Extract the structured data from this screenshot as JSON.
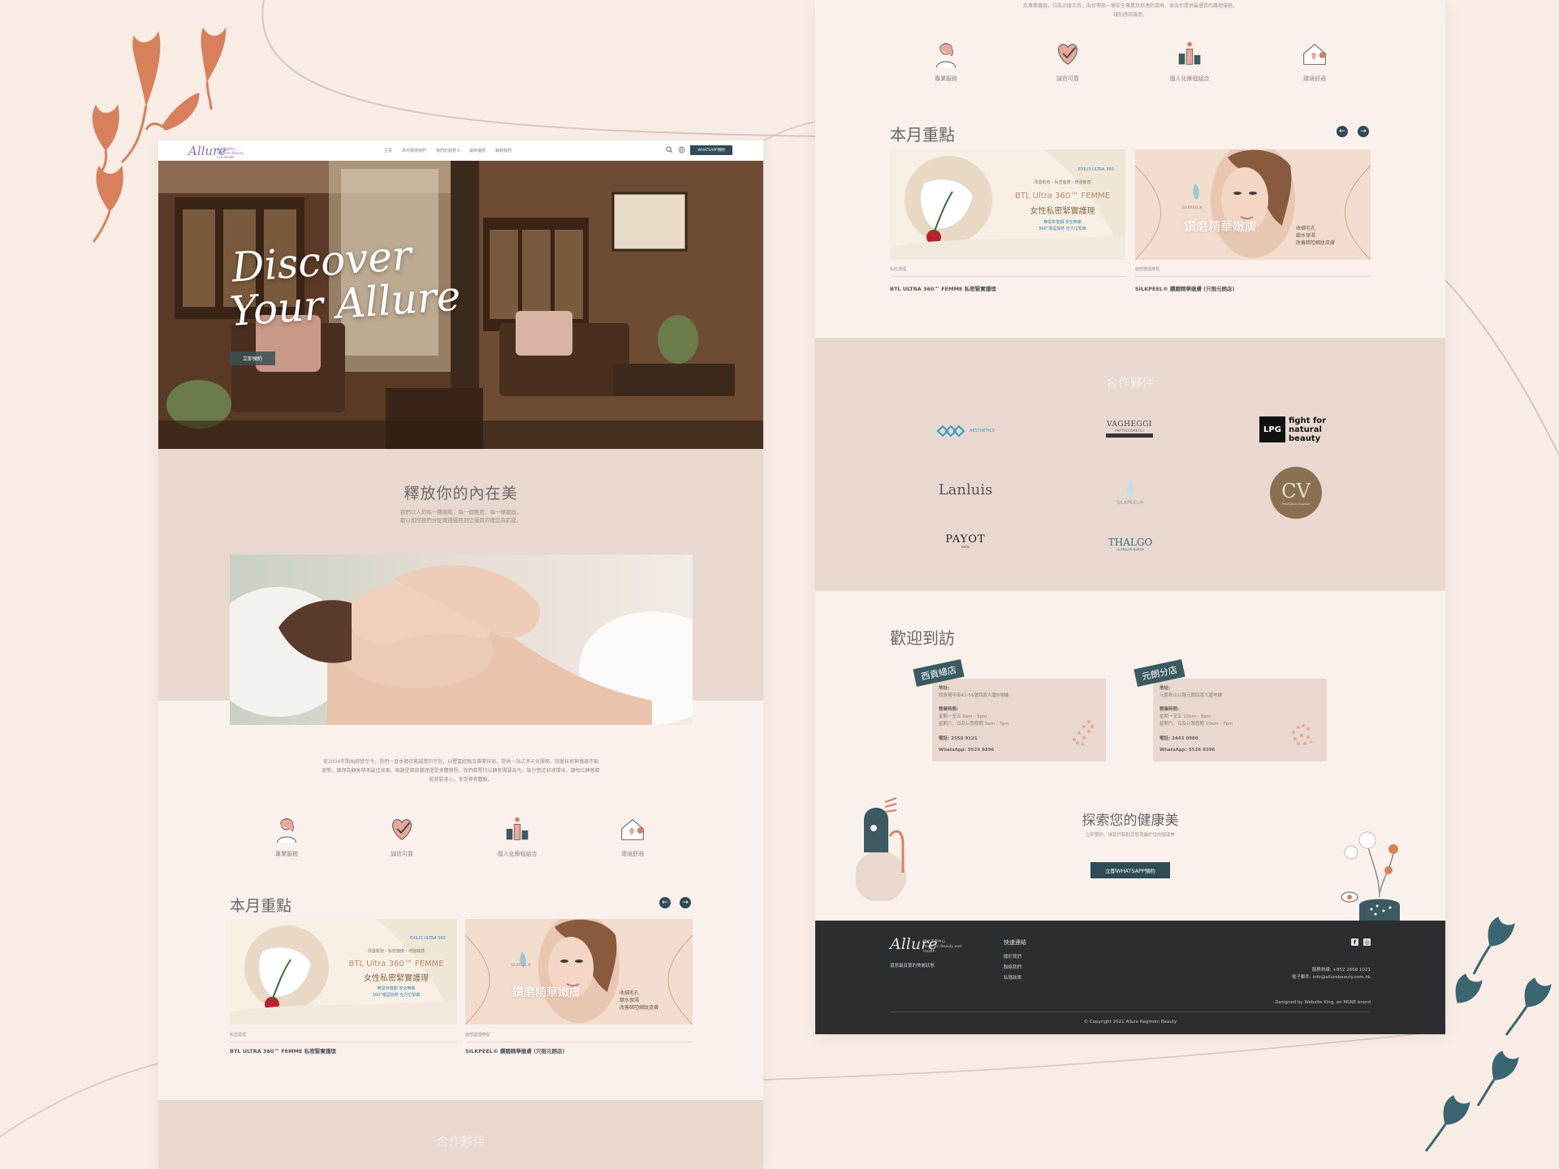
{
  "left_page": {
    "nav": {
      "logo": "Allure",
      "logo_sub": "瑞之美容中心 Regimen Beauty and Health",
      "links": [
        "主頁",
        "為何選擇我們",
        "我們的服務 ▾",
        "最新優惠",
        "聯絡我們"
      ],
      "whatsapp": "WHATSAPP預約"
    },
    "hero": {
      "title_line1": "Discover",
      "title_line2": "Your Allure",
      "button": "立即預約"
    },
    "intro": {
      "title": "釋放你的內在美",
      "sub1": "我們以人的每一種優點，每一個態度，每一條皺紋，",
      "sub2": "都以如何我們分配實踐優質到您優質的理念為前提。"
    },
    "about_text": "從2004年開始經營至今，我們一直本著待客誠懇的宗旨，以豐富經驗及專業技術，提供一站式多元化服務。隨著技術與儀器不斷更新，確保為顧客帶來最佳效果。無論是面部護理還是身體療程，我們都堅持以顧客需要為先，致力營造舒適環境，讓每位顧客都能放鬆身心，享受尊貴體驗。",
    "features": [
      "專業服務",
      "誠信可靠",
      "個人化療程組合",
      "環境舒適"
    ],
    "month": {
      "title": "本月重點",
      "promos": [
        {
          "category": "私密護理",
          "name": "BTL ULTRA 360™ FEMME 私密緊實護理",
          "brand": "EXILIS ULTRA 360",
          "line1": "改善鬆弛・私密健康・增強敏感",
          "line2": "BTL Ultra 360™ FEMME",
          "line3": "女性私密緊實護理",
          "line4": "無需恢復期 安全無痛",
          "line5": "360°環迴加熱 全方位緊緻"
        },
        {
          "category": "面部護理療程",
          "name": "SILKPEEL® 鑽磨精華嫩膚 (只限元朗店)",
          "brand": "SILKPEEL®",
          "line1": "鑽磨精華嫩膚",
          "line2": "收細毛孔",
          "line3": "鎖水保濕",
          "line4": "改善暗啞細紋皮膚"
        }
      ]
    },
    "partners_title": "合作夥伴"
  },
  "right_page": {
    "top_text1": "及專業儀器，均為正版正貨，為你帶來一個安全專業及舒適的環境，並為你提供最優質的護理服務，",
    "top_text2": "讓你感到滿意。",
    "features": [
      "專業服務",
      "誠信可靠",
      "個人化療程組合",
      "環境舒適"
    ],
    "month_title": "本月重點",
    "partners": {
      "title": "合作夥伴",
      "logos": [
        "AESTHETICS",
        "VAGHEGGI",
        "fight for natural beauty",
        "Lanluis",
        "SILKPEEL®",
        "CV",
        "PAYOT",
        "THALGO"
      ],
      "lpg": "LPG",
      "vagheggi_sub": "PHYTOCOSMETICI",
      "cv_sub": "Prestigious Essence",
      "payot_sub": "PARIS",
      "thalgo_sub": "LA BEAUTÉ MARINE"
    },
    "visit": {
      "title": "歡迎到訪",
      "stores": [
        {
          "tag": "西貢總店",
          "addr_label": "地址:",
          "addr": "西貢萬年街42-56號西貢大廈B地舖",
          "hours_label": "營業時間:",
          "hours1": "星期一至五 9am - 9pm",
          "hours2": "星期六、日及公眾假期 9am - 7pm",
          "phone": "電話: 2558 9121",
          "whatsapp": "WhatsApp: 5526 8396"
        },
        {
          "tag": "元朗分店",
          "addr_label": "地址:",
          "addr": "元朗青山公路元朗段某大廈地舖",
          "hours_label": "營業時間:",
          "hours1": "星期一至五 12pm - 9pm",
          "hours2": "星期六、日及公眾假期 10am - 7pm",
          "phone": "電話: 2443 0980",
          "whatsapp": "WhatsApp: 5526 8396"
        }
      ]
    },
    "explore": {
      "title": "探索您的健康美",
      "sub": "立即預約，讓我們幫助您發現屬於您的健康美",
      "button": "立即WHATSAPP預約"
    },
    "footer": {
      "logo": "Allure",
      "logo_sub": "瑞之美容中心 Regimen Beauty and Health",
      "tagline": "還原最真實的美麗狀態",
      "quick_title": "快速連結",
      "links": [
        "關於我們",
        "聯絡我們",
        "私隱政策"
      ],
      "phone": "服務熱線: +852 2668 1021",
      "email": "電子郵件: info@allurebeauty.com.hk",
      "designed": "Designed by Website King, an MSNE brand",
      "copyright": "© Copyright 2021 Allure Regimen Beauty"
    }
  },
  "colors": {
    "background": "#f8ece5",
    "band": "#e8d8cf",
    "accent_dark": "#2f4b55",
    "coral": "#d8805c",
    "teal": "#3b6570",
    "footer": "#2a2e30"
  }
}
